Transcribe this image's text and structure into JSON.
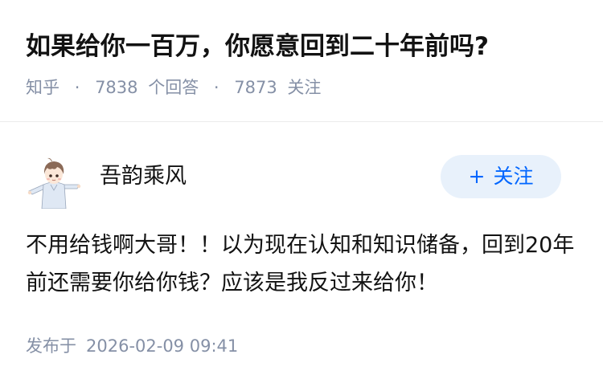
{
  "question": {
    "title": "如果给你一百万，你愿意回到二十年前吗?",
    "source": "知乎",
    "separator": "·",
    "answer_count": "7838",
    "answer_label": "个回答",
    "follower_count": "7873",
    "follower_label": "关注"
  },
  "author": {
    "name": "吾韵乘风",
    "avatar_icon": "anime-avatar-icon",
    "follow_plus": "+",
    "follow_label": "关注"
  },
  "answer": {
    "content": "不用给钱啊大哥！！以为现在认知和知识储备，回到20年前还需要你给你钱？应该是我反过来给你！",
    "publish_label": "发布于",
    "publish_time": "2026-02-09 09:41"
  },
  "colors": {
    "accent": "#0066ff",
    "muted": "#8590a6",
    "follow_bg": "#e8f1fb"
  }
}
